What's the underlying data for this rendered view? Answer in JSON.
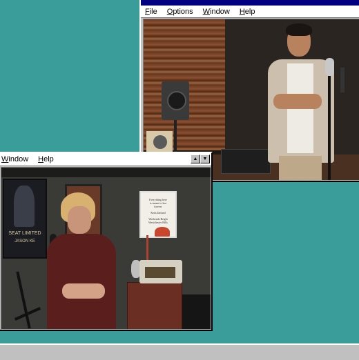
{
  "window_right": {
    "menu": [
      "File",
      "Options",
      "Window",
      "Help"
    ]
  },
  "window_left": {
    "menu": [
      "Window",
      "Help"
    ]
  },
  "poster": {
    "title": "SEAT LIMITED",
    "name": "JASON KE"
  },
  "frame_text": {
    "line1": "Everything here",
    "line2": "is meant to last",
    "line3": "forever",
    "line4": "Keds Dashed",
    "line5": "Weekends Bright",
    "line6": "Westchester Hills"
  },
  "colors": {
    "desktop": "#3a9d99",
    "titlebar": "#000080",
    "window_chrome": "#c0c0c0"
  },
  "icons": {
    "scroll_up": "▲",
    "scroll_down": "▼"
  }
}
